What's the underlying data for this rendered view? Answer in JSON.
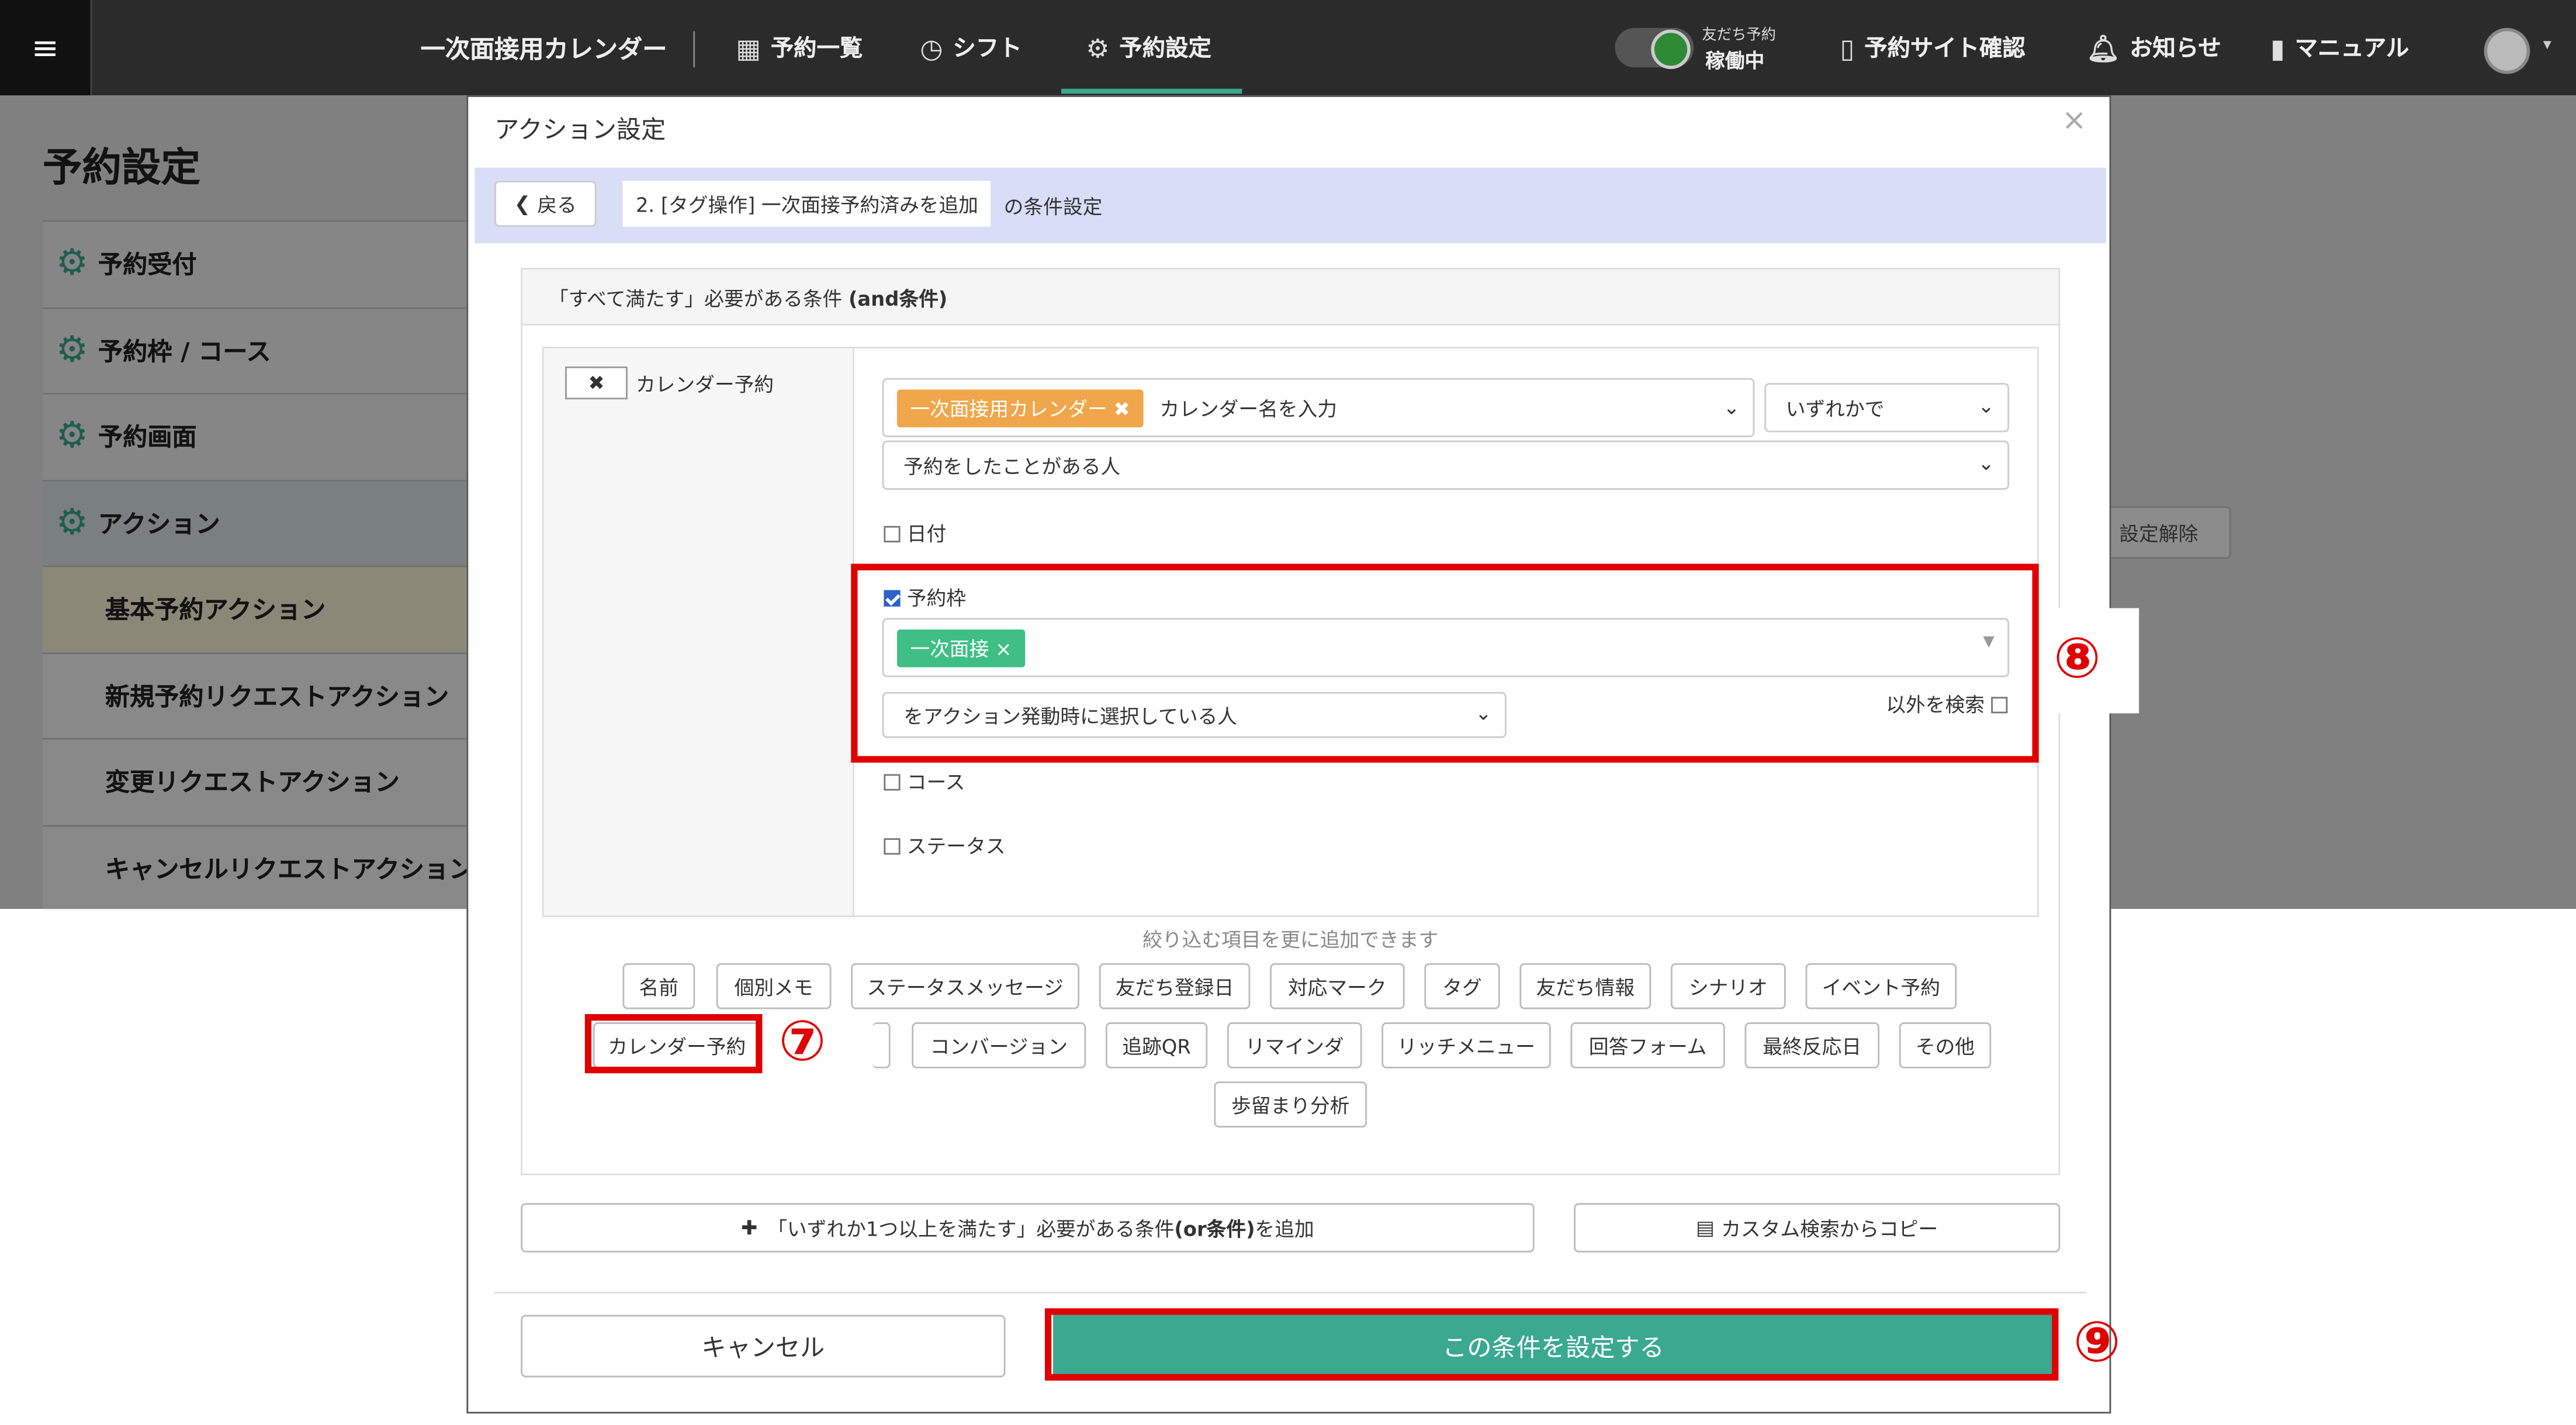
{
  "topbar": {
    "menu_icon": "hamburger-icon",
    "calendar_name": "一次面接用カレンダー",
    "nav": [
      {
        "label": "予約一覧",
        "icon": "calendar-grid-icon"
      },
      {
        "label": "シフト",
        "icon": "clock-icon"
      },
      {
        "label": "予約設定",
        "icon": "gear-icon"
      }
    ],
    "toggle_label_top": "友だち予約",
    "toggle_label_bottom": "稼働中",
    "right": [
      {
        "label": "予約サイト確認",
        "icon": "mobile-icon"
      },
      {
        "label": "お知らせ",
        "icon": "bell-icon"
      },
      {
        "label": "マニュアル",
        "icon": "book-icon"
      }
    ]
  },
  "page": {
    "title": "予約設定",
    "sidebar": [
      {
        "label": "予約受付",
        "icon": "gear-icon",
        "type": "main"
      },
      {
        "label": "予約枠 / コース",
        "icon": "gear-icon",
        "type": "main"
      },
      {
        "label": "予約画面",
        "icon": "gear-icon",
        "type": "main"
      },
      {
        "label": "アクション",
        "icon": "gear-icon",
        "type": "active"
      },
      {
        "label": "基本予約アクション",
        "type": "current"
      },
      {
        "label": "新規予約リクエストアクション",
        "type": "sub"
      },
      {
        "label": "変更リクエストアクション",
        "type": "sub"
      },
      {
        "label": "キャンセルリクエストアクション",
        "type": "sub"
      }
    ],
    "bg_button": "設定解除"
  },
  "modal": {
    "title": "アクション設定",
    "close": "×",
    "back_label": "戻る",
    "condition_name": "2. [タグ操作] 一次面接予約済みを追加",
    "condition_suffix": "の条件設定",
    "and_head_prefix": "「すべて満たす」必要がある条件 ",
    "and_head_bold": "(and条件)",
    "remove_icon": "✖",
    "condition_label": "カレンダー予約",
    "calendar_tag": "一次面接用カレンダー",
    "calendar_placeholder": "カレンダー名を入力",
    "match_select": "いずれかで",
    "reservation_select": "予約をしたことがある人",
    "date_label": "日付",
    "slot_label": "予約枠",
    "slot_tag": "一次面接",
    "slot_select": "をアクション発動時に選択している人",
    "exclude_label": "以外を検索",
    "course_label": "コース",
    "status_label": "ステータス",
    "hint": "絞り込む項目を更に追加できます",
    "filters_row1": [
      "名前",
      "個別メモ",
      "ステータスメッセージ",
      "友だち登録日",
      "対応マーク",
      "タグ",
      "友だち情報",
      "シナリオ",
      "イベント予約"
    ],
    "filters_row2": [
      "カレンダー予約",
      "コンバージョン",
      "追跡QR",
      "リマインダ",
      "リッチメニュー",
      "回答フォーム",
      "最終反応日",
      "その他"
    ],
    "filters_row3": [
      "歩留まり分析"
    ],
    "or_button": "「いずれか1つ以上を満たす」必要がある条件",
    "or_button_bold": "(or条件)",
    "or_button_suffix": "を追加",
    "copy_button": "カスタム検索からコピー",
    "cancel": "キャンセル",
    "submit": "この条件を設定する"
  },
  "callouts": {
    "seven": "⑦",
    "eight": "⑧",
    "nine": "⑨"
  },
  "colors": {
    "accent": "#3aa990",
    "callout": "#e00000",
    "calendar_tag": "#f0a64a",
    "slot_tag": "#3fbf85"
  }
}
